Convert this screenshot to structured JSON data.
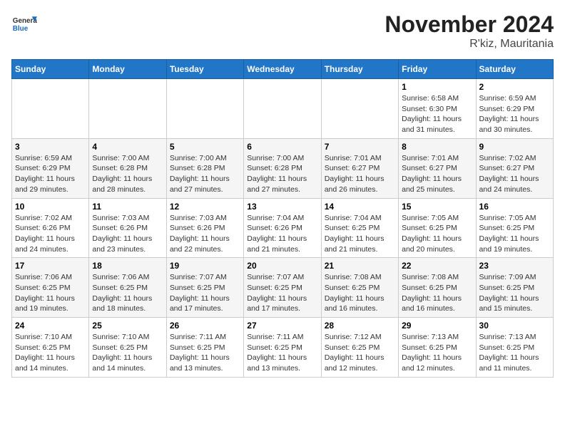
{
  "logo": {
    "general": "General",
    "blue": "Blue"
  },
  "title": "November 2024",
  "subtitle": "R'kiz, Mauritania",
  "days_header": [
    "Sunday",
    "Monday",
    "Tuesday",
    "Wednesday",
    "Thursday",
    "Friday",
    "Saturday"
  ],
  "weeks": [
    [
      {
        "day": "",
        "info": ""
      },
      {
        "day": "",
        "info": ""
      },
      {
        "day": "",
        "info": ""
      },
      {
        "day": "",
        "info": ""
      },
      {
        "day": "",
        "info": ""
      },
      {
        "day": "1",
        "info": "Sunrise: 6:58 AM\nSunset: 6:30 PM\nDaylight: 11 hours and 31 minutes."
      },
      {
        "day": "2",
        "info": "Sunrise: 6:59 AM\nSunset: 6:29 PM\nDaylight: 11 hours and 30 minutes."
      }
    ],
    [
      {
        "day": "3",
        "info": "Sunrise: 6:59 AM\nSunset: 6:29 PM\nDaylight: 11 hours and 29 minutes."
      },
      {
        "day": "4",
        "info": "Sunrise: 7:00 AM\nSunset: 6:28 PM\nDaylight: 11 hours and 28 minutes."
      },
      {
        "day": "5",
        "info": "Sunrise: 7:00 AM\nSunset: 6:28 PM\nDaylight: 11 hours and 27 minutes."
      },
      {
        "day": "6",
        "info": "Sunrise: 7:00 AM\nSunset: 6:28 PM\nDaylight: 11 hours and 27 minutes."
      },
      {
        "day": "7",
        "info": "Sunrise: 7:01 AM\nSunset: 6:27 PM\nDaylight: 11 hours and 26 minutes."
      },
      {
        "day": "8",
        "info": "Sunrise: 7:01 AM\nSunset: 6:27 PM\nDaylight: 11 hours and 25 minutes."
      },
      {
        "day": "9",
        "info": "Sunrise: 7:02 AM\nSunset: 6:27 PM\nDaylight: 11 hours and 24 minutes."
      }
    ],
    [
      {
        "day": "10",
        "info": "Sunrise: 7:02 AM\nSunset: 6:26 PM\nDaylight: 11 hours and 24 minutes."
      },
      {
        "day": "11",
        "info": "Sunrise: 7:03 AM\nSunset: 6:26 PM\nDaylight: 11 hours and 23 minutes."
      },
      {
        "day": "12",
        "info": "Sunrise: 7:03 AM\nSunset: 6:26 PM\nDaylight: 11 hours and 22 minutes."
      },
      {
        "day": "13",
        "info": "Sunrise: 7:04 AM\nSunset: 6:26 PM\nDaylight: 11 hours and 21 minutes."
      },
      {
        "day": "14",
        "info": "Sunrise: 7:04 AM\nSunset: 6:25 PM\nDaylight: 11 hours and 21 minutes."
      },
      {
        "day": "15",
        "info": "Sunrise: 7:05 AM\nSunset: 6:25 PM\nDaylight: 11 hours and 20 minutes."
      },
      {
        "day": "16",
        "info": "Sunrise: 7:05 AM\nSunset: 6:25 PM\nDaylight: 11 hours and 19 minutes."
      }
    ],
    [
      {
        "day": "17",
        "info": "Sunrise: 7:06 AM\nSunset: 6:25 PM\nDaylight: 11 hours and 19 minutes."
      },
      {
        "day": "18",
        "info": "Sunrise: 7:06 AM\nSunset: 6:25 PM\nDaylight: 11 hours and 18 minutes."
      },
      {
        "day": "19",
        "info": "Sunrise: 7:07 AM\nSunset: 6:25 PM\nDaylight: 11 hours and 17 minutes."
      },
      {
        "day": "20",
        "info": "Sunrise: 7:07 AM\nSunset: 6:25 PM\nDaylight: 11 hours and 17 minutes."
      },
      {
        "day": "21",
        "info": "Sunrise: 7:08 AM\nSunset: 6:25 PM\nDaylight: 11 hours and 16 minutes."
      },
      {
        "day": "22",
        "info": "Sunrise: 7:08 AM\nSunset: 6:25 PM\nDaylight: 11 hours and 16 minutes."
      },
      {
        "day": "23",
        "info": "Sunrise: 7:09 AM\nSunset: 6:25 PM\nDaylight: 11 hours and 15 minutes."
      }
    ],
    [
      {
        "day": "24",
        "info": "Sunrise: 7:10 AM\nSunset: 6:25 PM\nDaylight: 11 hours and 14 minutes."
      },
      {
        "day": "25",
        "info": "Sunrise: 7:10 AM\nSunset: 6:25 PM\nDaylight: 11 hours and 14 minutes."
      },
      {
        "day": "26",
        "info": "Sunrise: 7:11 AM\nSunset: 6:25 PM\nDaylight: 11 hours and 13 minutes."
      },
      {
        "day": "27",
        "info": "Sunrise: 7:11 AM\nSunset: 6:25 PM\nDaylight: 11 hours and 13 minutes."
      },
      {
        "day": "28",
        "info": "Sunrise: 7:12 AM\nSunset: 6:25 PM\nDaylight: 11 hours and 12 minutes."
      },
      {
        "day": "29",
        "info": "Sunrise: 7:13 AM\nSunset: 6:25 PM\nDaylight: 11 hours and 12 minutes."
      },
      {
        "day": "30",
        "info": "Sunrise: 7:13 AM\nSunset: 6:25 PM\nDaylight: 11 hours and 11 minutes."
      }
    ]
  ]
}
